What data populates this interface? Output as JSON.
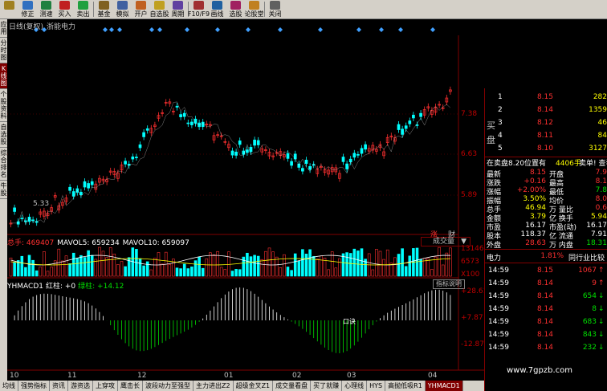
{
  "toolbar": [
    {
      "label": "",
      "color": "#a08020"
    },
    {
      "label": "修正",
      "color": "#3070c0"
    },
    {
      "label": "测速",
      "color": "#208040"
    },
    {
      "label": "买入",
      "color": "#c02020"
    },
    {
      "label": "卖出",
      "color": "#20a040"
    },
    {
      "label": "基金",
      "color": "#806020"
    },
    {
      "label": "模拟",
      "color": "#4060a0"
    },
    {
      "label": "开户",
      "color": "#c06020"
    },
    {
      "label": "自选股",
      "color": "#c0a020"
    },
    {
      "label": "周期",
      "color": "#6040a0"
    },
    {
      "label": "F10/F9",
      "color": "#a03030"
    },
    {
      "label": "画线",
      "color": "#2060a0"
    },
    {
      "label": "选股",
      "color": "#a02060"
    },
    {
      "label": "论股堂",
      "color": "#c08020"
    },
    {
      "label": "关闭",
      "color": "#606060"
    }
  ],
  "vtabs": [
    {
      "label": "应用",
      "active": false
    },
    {
      "label": "分时图",
      "active": false
    },
    {
      "label": "K线图",
      "active": true
    },
    {
      "label": "个股资料",
      "active": false
    },
    {
      "label": "自选股",
      "active": false
    },
    {
      "label": "综合排名",
      "active": false
    },
    {
      "label": "牛股",
      "active": false
    }
  ],
  "chart": {
    "title": "日线(复权)",
    "stock": "浙能电力",
    "price_ticks": [
      "7.38",
      "6.63",
      "5.89"
    ],
    "low_label": "5.33",
    "vol_header": [
      {
        "text": "总手: 469407",
        "color": "#ff3030"
      },
      {
        "text": "MAVOL5: 659234",
        "color": "#ffffff"
      },
      {
        "text": "MAVOL10: 659097",
        "color": "#ffffff"
      }
    ],
    "vol_ticks": [
      "13146",
      "6573",
      "X100"
    ],
    "vol_dropdown": "成交量",
    "macd_header": [
      {
        "text": "YHMACD1",
        "color": "#ffffff"
      },
      {
        "text": "红柱: +0",
        "color": "#ffffff"
      },
      {
        "text": "绿柱: +14.12",
        "color": "#00e000"
      }
    ],
    "macd_ticks": [
      "+28.61",
      "+7.87",
      "-12.87"
    ],
    "ind_button": "指标说明",
    "tag_zhang": "涨",
    "tag_cai": "财",
    "macd_text_1": "買進",
    "macd_text_2": "賣出",
    "macd_text_3": "口诀",
    "x_labels": [
      "10",
      "11",
      "12",
      "01",
      "02",
      "03",
      "04"
    ]
  },
  "bottom_tabs": [
    {
      "label": "均线",
      "active": false
    },
    {
      "label": "强势指标",
      "active": false
    },
    {
      "label": "资讯",
      "active": false
    },
    {
      "label": "游资选",
      "active": false
    },
    {
      "label": "上穿攻",
      "active": false
    },
    {
      "label": "鹰击长",
      "active": false
    },
    {
      "label": "波段动力至强型",
      "active": false
    },
    {
      "label": "主力进出Z2",
      "active": false
    },
    {
      "label": "超级金叉Z1",
      "active": false
    },
    {
      "label": "成交量看盘",
      "active": false
    },
    {
      "label": "买了就赚",
      "active": false
    },
    {
      "label": "心理线",
      "active": false
    },
    {
      "label": "HYS",
      "active": false
    },
    {
      "label": "高抛低吸R1",
      "active": false
    },
    {
      "label": "YHMACD1",
      "active": true
    }
  ],
  "quote": {
    "asks": [
      {
        "level": "1",
        "price": "8.15",
        "vol": "282"
      },
      {
        "level": "2",
        "price": "8.14",
        "vol": "1359"
      },
      {
        "level": "3",
        "price": "8.12",
        "vol": "46"
      },
      {
        "level": "4",
        "price": "8.11",
        "vol": "84"
      },
      {
        "level": "5",
        "price": "8.10",
        "vol": "3127"
      }
    ],
    "side_label_1": "买",
    "side_label_2": "盘",
    "order_line": "在卖盘8.20位置有",
    "order_vol": "4406手",
    "order_tail": "卖单! 查看详情",
    "stats": [
      {
        "l1": "最新",
        "v1": "8.15",
        "c1": "red",
        "l2": "开盘",
        "v2": "7.9",
        "c2": "red"
      },
      {
        "l1": "涨跌",
        "v1": "+0.16",
        "c1": "red",
        "l2": "最高",
        "v2": "8.1",
        "c2": "red"
      },
      {
        "l1": "涨幅",
        "v1": "+2.00%",
        "c1": "red",
        "l2": "最低",
        "v2": "7.8",
        "c2": "green"
      },
      {
        "l1": "振幅",
        "v1": "3.50%",
        "c1": "yellow",
        "l2": "均价",
        "v2": "8.0",
        "c2": "red"
      },
      {
        "l1": "总手",
        "v1": "46.94",
        "c1": "yellow",
        "l2": "万 量比",
        "v2": "0.6",
        "c2": "red"
      },
      {
        "l1": "金额",
        "v1": "3.79",
        "c1": "yellow",
        "l2": "亿 换手",
        "v2": "5.94",
        "c2": "yellow"
      },
      {
        "l1": "市盈",
        "v1": "16.17",
        "c1": "white",
        "l2": "市盈(动)",
        "v2": "16.17",
        "c2": "white"
      },
      {
        "l1": "股本",
        "v1": "118.37",
        "c1": "white",
        "l2": "亿 流通",
        "v2": "7.91",
        "c2": "white"
      },
      {
        "l1": "外盘",
        "v1": "28.63",
        "c1": "red",
        "l2": "万 内盘",
        "v2": "18.31",
        "c2": "green"
      }
    ],
    "sector_name": "电力",
    "sector_change": "1.81%",
    "sector_compare": "同行业比较",
    "ticks": [
      {
        "time": "14:59",
        "price": "8.15",
        "vol": "1067",
        "dir": "up"
      },
      {
        "time": "14:59",
        "price": "8.14",
        "vol": "9",
        "dir": "up"
      },
      {
        "time": "14:59",
        "price": "8.14",
        "vol": "654",
        "dir": "down"
      },
      {
        "time": "14:59",
        "price": "8.14",
        "vol": "8",
        "dir": "down"
      },
      {
        "time": "14:59",
        "price": "8.14",
        "vol": "683",
        "dir": "down"
      },
      {
        "time": "14:59",
        "price": "8.14",
        "vol": "843",
        "dir": "down"
      },
      {
        "time": "14:59",
        "price": "8.14",
        "vol": "232",
        "dir": "down"
      }
    ]
  },
  "watermark": "www.7gpzb.com"
}
